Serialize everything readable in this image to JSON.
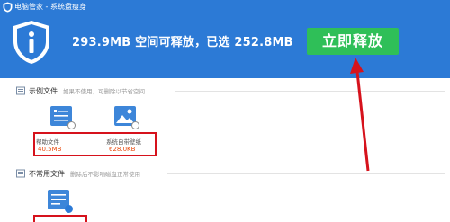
{
  "app": {
    "title": "电脑管家 - 系统盘瘦身"
  },
  "header": {
    "headline": "293.9MB 空间可释放，已选 252.8MB",
    "release_button": "立即释放"
  },
  "sections": [
    {
      "title": "示例文件",
      "description": "如果不使用，可删除以节省空间",
      "items": [
        {
          "name": "帮助文件",
          "size": "40.5MB",
          "icon": "document-icon"
        },
        {
          "name": "系统自带壁纸",
          "size": "628.0KB",
          "icon": "image-icon"
        }
      ]
    },
    {
      "title": "不常用文件",
      "description": "删除后不影响磁盘正常使用",
      "items": [
        {
          "name": "",
          "size": "",
          "icon": "document-check-icon"
        }
      ]
    }
  ],
  "colors": {
    "header_bg": "#2c7ad6",
    "release_button": "#2fbf58",
    "size_text": "#e8480c",
    "annotation_red": "#d6121c"
  }
}
